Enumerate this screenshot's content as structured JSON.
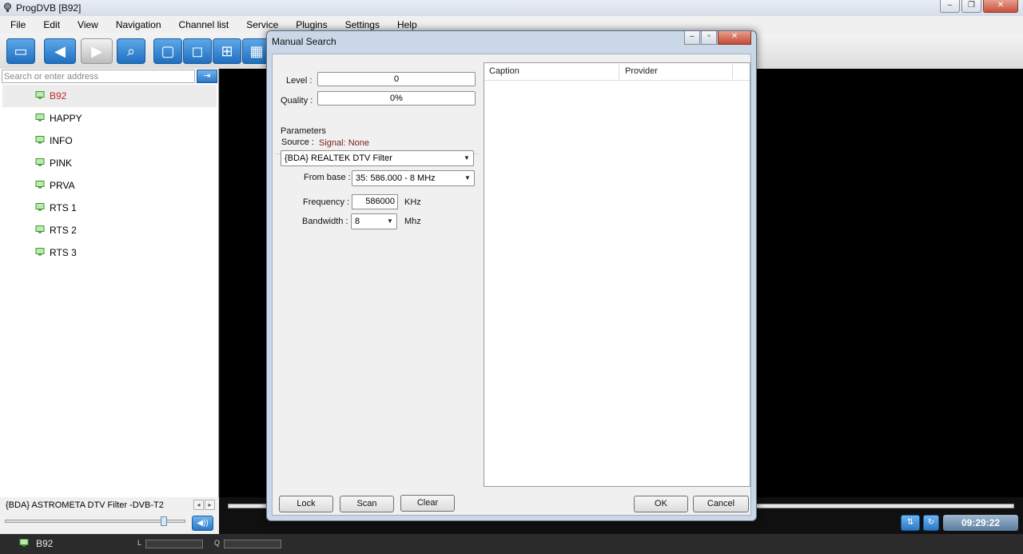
{
  "window": {
    "title": "ProgDVB [B92]",
    "controls": {
      "minimize": "‒",
      "maximize": "❐",
      "close": "✕"
    }
  },
  "menu": [
    "File",
    "Edit",
    "View",
    "Navigation",
    "Channel list",
    "Service",
    "Plugins",
    "Settings",
    "Help"
  ],
  "toolbar_icons": [
    "panel-icon",
    "back-icon",
    "forward-icon",
    "search-icon",
    "window-icon",
    "fullscreen-icon",
    "grid-4-icon",
    "grid-9-icon"
  ],
  "search": {
    "placeholder": "Search or enter address",
    "go_icon": "⇥"
  },
  "channels": [
    {
      "name": "B92",
      "selected": true
    },
    {
      "name": "HAPPY"
    },
    {
      "name": "INFO"
    },
    {
      "name": "PINK"
    },
    {
      "name": "PRVA"
    },
    {
      "name": "RTS 1"
    },
    {
      "name": "RTS 2"
    },
    {
      "name": "RTS 3"
    }
  ],
  "left_status": {
    "source": "{BDA} ASTROMETA DTV Filter -DVB-T2",
    "prev": "◂",
    "next": "▸"
  },
  "volume": {
    "level": 0.88,
    "icon": "volume-icon"
  },
  "clock": "09:29:22",
  "statusbar": {
    "channel": "B92",
    "level_label": "L",
    "quality_label": "Q"
  },
  "dialog": {
    "title": "Manual Search",
    "controls": {
      "minimize": "‒",
      "maximize": "▫",
      "close": "✕"
    },
    "level": {
      "label": "Level :",
      "value": "0"
    },
    "quality": {
      "label": "Quality :",
      "value": "0%"
    },
    "signal": "Signal: None",
    "parameters_label": "Parameters",
    "source": {
      "label": "Source :",
      "value": "{BDA} REALTEK DTV Filter"
    },
    "from_base": {
      "label": "From base :",
      "value": "35: 586.000 - 8 MHz"
    },
    "frequency": {
      "label": "Frequency :",
      "value": "586000",
      "unit": "KHz"
    },
    "bandwidth": {
      "label": "Bandwidth :",
      "value": "8",
      "unit": "Mhz"
    },
    "list": {
      "columns": [
        "Caption",
        "Provider"
      ]
    },
    "buttons": {
      "lock": "Lock",
      "scan": "Scan",
      "clear": "Clear",
      "ok": "OK",
      "cancel": "Cancel"
    }
  },
  "colors": {
    "accent_blue": "#2a78c8",
    "selected_channel": "#c0282a",
    "signal_text": "#7a1c1c",
    "video_bg": "#000000"
  }
}
